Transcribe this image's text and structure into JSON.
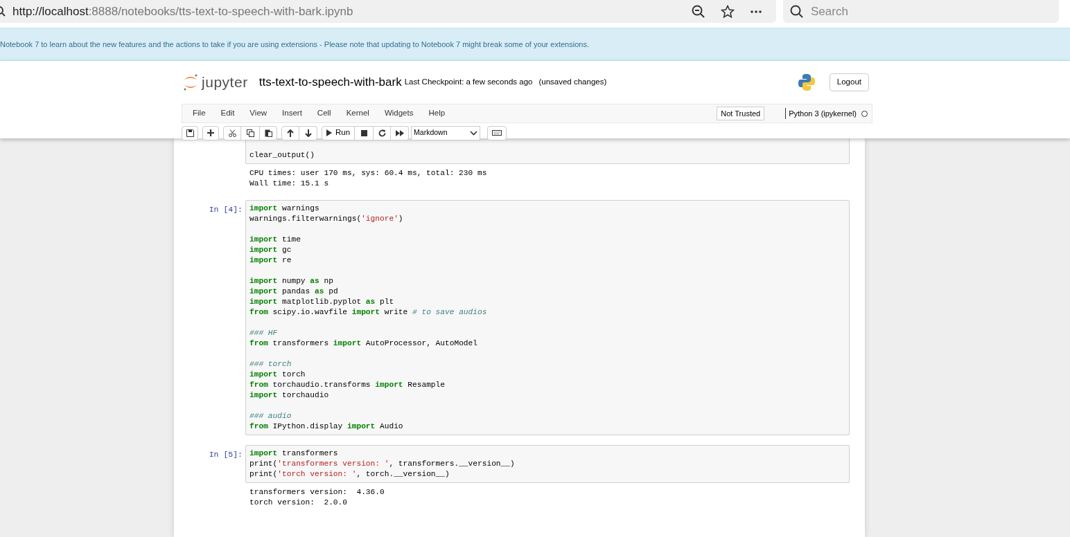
{
  "browser": {
    "url_host": "http://localhost",
    "url_rest": ":8888/notebooks/tts-text-to-speech-with-bark.ipynb",
    "search_placeholder": "Search"
  },
  "banner": {
    "text": "Notebook 7 to learn about the new features and the actions to take if you are using extensions - Please note that updating to Notebook 7 might break some of your extensions."
  },
  "header": {
    "logo_text": "jupyter",
    "notebook_name": "tts-text-to-speech-with-bark",
    "checkpoint": "Last Checkpoint: a few seconds ago",
    "unsaved": "(unsaved changes)",
    "logout": "Logout"
  },
  "menu": [
    {
      "label": "File"
    },
    {
      "label": "Edit"
    },
    {
      "label": "View"
    },
    {
      "label": "Insert"
    },
    {
      "label": "Cell"
    },
    {
      "label": "Kernel"
    },
    {
      "label": "Widgets"
    },
    {
      "label": "Help"
    }
  ],
  "trust": "Not Trusted",
  "kernel": {
    "name": "Python 3 (ipykernel)",
    "busy": false
  },
  "toolbar": {
    "run_label": "Run",
    "cell_type": "Markdown"
  },
  "cells": [
    {
      "blocks": [
        [
          [
            {
              "kind": "plain",
              "t": "clear_output()"
            }
          ]
        ]
      ],
      "output": [
        "CPU times: user 170 ms, sys: 60.4 ms, total: 230 ms",
        "Wall time: 15.1 s"
      ]
    },
    {
      "prompt": "In [4]:",
      "blocks": [
        [
          [
            {
              "kind": "keyword",
              "t": "import"
            },
            {
              "kind": "plain",
              "t": " warnings"
            }
          ],
          [
            {
              "kind": "plain",
              "t": "warnings.filterwarnings("
            },
            {
              "kind": "string",
              "t": "'ignore'"
            },
            {
              "kind": "plain",
              "t": ")"
            }
          ]
        ],
        [
          [
            {
              "kind": "keyword",
              "t": "import"
            },
            {
              "kind": "plain",
              "t": " time"
            }
          ],
          [
            {
              "kind": "keyword",
              "t": "import"
            },
            {
              "kind": "plain",
              "t": " gc"
            }
          ],
          [
            {
              "kind": "keyword",
              "t": "import"
            },
            {
              "kind": "plain",
              "t": " re"
            }
          ]
        ],
        [
          [
            {
              "kind": "keyword",
              "t": "import"
            },
            {
              "kind": "plain",
              "t": " numpy "
            },
            {
              "kind": "keyword",
              "t": "as"
            },
            {
              "kind": "plain",
              "t": " np"
            }
          ],
          [
            {
              "kind": "keyword",
              "t": "import"
            },
            {
              "kind": "plain",
              "t": " pandas "
            },
            {
              "kind": "keyword",
              "t": "as"
            },
            {
              "kind": "plain",
              "t": " pd"
            }
          ],
          [
            {
              "kind": "keyword",
              "t": "import"
            },
            {
              "kind": "plain",
              "t": " matplotlib.pyplot "
            },
            {
              "kind": "keyword",
              "t": "as"
            },
            {
              "kind": "plain",
              "t": " plt"
            }
          ],
          [
            {
              "kind": "keyword",
              "t": "from"
            },
            {
              "kind": "plain",
              "t": " scipy.io.wavfile "
            },
            {
              "kind": "keyword",
              "t": "import"
            },
            {
              "kind": "plain",
              "t": " write "
            },
            {
              "kind": "comment",
              "t": "# to save audios"
            }
          ]
        ],
        [
          [
            {
              "kind": "comment",
              "t": "### HF"
            }
          ],
          [
            {
              "kind": "keyword",
              "t": "from"
            },
            {
              "kind": "plain",
              "t": " transformers "
            },
            {
              "kind": "keyword",
              "t": "import"
            },
            {
              "kind": "plain",
              "t": " AutoProcessor, AutoModel"
            }
          ]
        ],
        [
          [
            {
              "kind": "comment",
              "t": "### torch"
            }
          ],
          [
            {
              "kind": "keyword",
              "t": "import"
            },
            {
              "kind": "plain",
              "t": " torch"
            }
          ],
          [
            {
              "kind": "keyword",
              "t": "from"
            },
            {
              "kind": "plain",
              "t": " torchaudio.transforms "
            },
            {
              "kind": "keyword",
              "t": "import"
            },
            {
              "kind": "plain",
              "t": " Resample"
            }
          ],
          [
            {
              "kind": "keyword",
              "t": "import"
            },
            {
              "kind": "plain",
              "t": " torchaudio"
            }
          ]
        ],
        [
          [
            {
              "kind": "comment",
              "t": "### audio"
            }
          ],
          [
            {
              "kind": "keyword",
              "t": "from"
            },
            {
              "kind": "plain",
              "t": " IPython.display "
            },
            {
              "kind": "keyword",
              "t": "import"
            },
            {
              "kind": "plain",
              "t": " Audio"
            }
          ]
        ]
      ]
    },
    {
      "prompt": "In [5]:",
      "blocks": [
        [
          [
            {
              "kind": "keyword",
              "t": "import"
            },
            {
              "kind": "plain",
              "t": " transformers"
            }
          ],
          [
            {
              "kind": "plain",
              "t": "print("
            },
            {
              "kind": "string",
              "t": "'transformers version: '"
            },
            {
              "kind": "plain",
              "t": ", transformers.__version__)"
            }
          ],
          [
            {
              "kind": "plain",
              "t": "print("
            },
            {
              "kind": "string",
              "t": "'torch version: '"
            },
            {
              "kind": "plain",
              "t": ", torch.__version__)"
            }
          ]
        ]
      ],
      "output": [
        "transformers version:  4.36.0",
        "torch version:  2.0.0"
      ]
    }
  ]
}
